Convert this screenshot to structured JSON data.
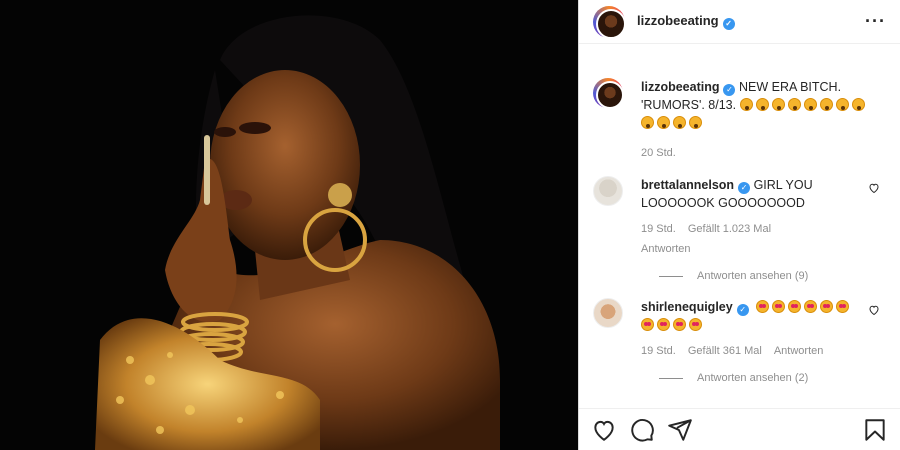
{
  "post": {
    "author": "lizzobeeating",
    "caption_text": "NEW ERA BITCH. 'RUMORS'. 8/13.",
    "caption_emoji_count": 12,
    "age": "20 Std."
  },
  "comments": [
    {
      "username": "brettalannelson",
      "verified": true,
      "text": "GIRL YOU LOOOOOOK GOOOOOOOD",
      "age": "19 Std.",
      "likes": "Gefällt 1.023 Mal",
      "reply": "Antworten",
      "view_replies": "Antworten ansehen (9)"
    },
    {
      "username": "shirlenequigley",
      "verified": true,
      "emoji_count": 10,
      "age": "19 Std.",
      "likes": "Gefällt 361 Mal",
      "reply": "Antworten",
      "view_replies": "Antworten ansehen (2)"
    }
  ],
  "icons": {
    "header_more": "more-options-icon",
    "like": "heart-icon",
    "comment": "comment-icon",
    "share": "share-icon",
    "save": "bookmark-icon"
  },
  "colors": {
    "verified": "#3897f0",
    "muted": "#8e8e8e",
    "text": "#262626"
  }
}
